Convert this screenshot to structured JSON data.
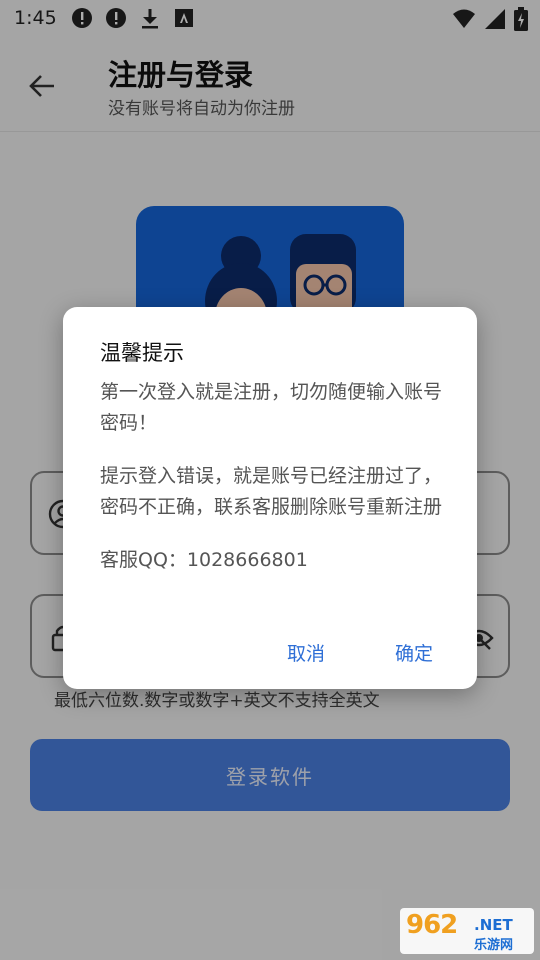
{
  "status_bar": {
    "time": "1:45",
    "left_icons": [
      "alert-icon",
      "alert-icon",
      "download-icon",
      "font-icon"
    ],
    "right_icons": [
      "wifi-icon",
      "signal-icon",
      "battery-icon"
    ]
  },
  "app_bar": {
    "title": "注册与登录",
    "subtitle": "没有账号将自动为你注册"
  },
  "form": {
    "account_value": "",
    "password_value": "",
    "password_hint": "最低六位数.数字或数字+英文不支持全英文",
    "login_label": "登录软件"
  },
  "dialog": {
    "title": "温馨提示",
    "paragraph1": "第一次登入就是注册，切勿随便输入账号密码！",
    "paragraph2": "提示登入错误，就是账号已经注册过了，密码不正确，联系客服删除账号重新注册",
    "qq": "客服QQ：1028666801",
    "cancel_label": "取消",
    "ok_label": "确定"
  },
  "watermark": {
    "number": "962",
    "domain": ".NET",
    "site": "乐游网"
  },
  "colors": {
    "accent": "#2f6fd6",
    "hero": "#1565d8",
    "button": "#4a7fe0"
  }
}
